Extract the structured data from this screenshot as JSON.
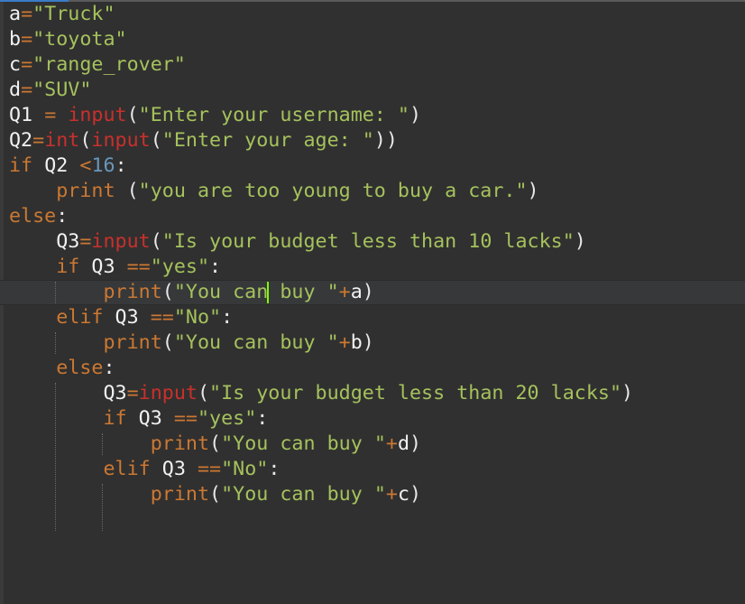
{
  "editor": {
    "theme_colors": {
      "background": "#303030",
      "keyword": "#cc7832",
      "builtin": "#c9302c",
      "string": "#a5c25c",
      "number": "#6897bb",
      "name": "#f2f2f2",
      "caret": "#7cfc00",
      "tab_active": "#3a7bc8"
    },
    "current_line": 12,
    "lines": [
      {
        "indent": 0,
        "tokens": [
          [
            "nm",
            "a"
          ],
          [
            "op",
            "="
          ],
          [
            "st",
            "\"Truck\""
          ]
        ]
      },
      {
        "indent": 0,
        "tokens": [
          [
            "nm",
            "b"
          ],
          [
            "op",
            "="
          ],
          [
            "st",
            "\"toyota\""
          ]
        ]
      },
      {
        "indent": 0,
        "tokens": [
          [
            "nm",
            "c"
          ],
          [
            "op",
            "="
          ],
          [
            "st",
            "\"range_rover\""
          ]
        ]
      },
      {
        "indent": 0,
        "tokens": [
          [
            "nm",
            "d"
          ],
          [
            "op",
            "="
          ],
          [
            "st",
            "\"SUV\""
          ]
        ]
      },
      {
        "indent": 0,
        "tokens": [
          [
            "nm",
            "Q1"
          ],
          [
            "pn",
            " "
          ],
          [
            "op",
            "="
          ],
          [
            "pn",
            " "
          ],
          [
            "bi",
            "input"
          ],
          [
            "pn",
            "("
          ],
          [
            "st",
            "\"Enter your username: \""
          ],
          [
            "pn",
            ")"
          ]
        ]
      },
      {
        "indent": 0,
        "tokens": [
          [
            "nm",
            "Q2"
          ],
          [
            "op",
            "="
          ],
          [
            "bi",
            "int"
          ],
          [
            "pn",
            "("
          ],
          [
            "bi",
            "input"
          ],
          [
            "pn",
            "("
          ],
          [
            "st",
            "\"Enter your age: \""
          ],
          [
            "pn",
            "))"
          ]
        ]
      },
      {
        "indent": 0,
        "tokens": [
          [
            "kw",
            "if"
          ],
          [
            "pn",
            " "
          ],
          [
            "nm",
            "Q2"
          ],
          [
            "pn",
            " "
          ],
          [
            "op",
            "<"
          ],
          [
            "nu",
            "16"
          ],
          [
            "pn",
            ":"
          ]
        ]
      },
      {
        "indent": 1,
        "tokens": [
          [
            "kw",
            "print"
          ],
          [
            "pn",
            " ("
          ],
          [
            "st",
            "\"you are too young to buy a car.\""
          ],
          [
            "pn",
            ")"
          ]
        ]
      },
      {
        "indent": 0,
        "tokens": [
          [
            "kw",
            "else"
          ],
          [
            "pn",
            ":"
          ]
        ]
      },
      {
        "indent": 1,
        "tokens": [
          [
            "nm",
            "Q3"
          ],
          [
            "op",
            "="
          ],
          [
            "bi",
            "input"
          ],
          [
            "pn",
            "("
          ],
          [
            "st",
            "\"Is your budget less than 10 lacks\""
          ],
          [
            "pn",
            ")"
          ]
        ]
      },
      {
        "indent": 1,
        "tokens": [
          [
            "kw",
            "if"
          ],
          [
            "pn",
            " "
          ],
          [
            "nm",
            "Q3"
          ],
          [
            "pn",
            " "
          ],
          [
            "op",
            "=="
          ],
          [
            "st",
            "\"yes\""
          ],
          [
            "pn",
            ":"
          ]
        ]
      },
      {
        "indent": 2,
        "tokens": [
          [
            "kw",
            "print"
          ],
          [
            "pn",
            "("
          ],
          [
            "st",
            "\"You can buy \""
          ],
          [
            "op",
            "+"
          ],
          [
            "nm",
            "a"
          ],
          [
            "pn",
            ")"
          ]
        ]
      },
      {
        "indent": 1,
        "tokens": [
          [
            "kw",
            "elif"
          ],
          [
            "pn",
            " "
          ],
          [
            "nm",
            "Q3"
          ],
          [
            "pn",
            " "
          ],
          [
            "op",
            "=="
          ],
          [
            "st",
            "\"No\""
          ],
          [
            "pn",
            ":"
          ]
        ]
      },
      {
        "indent": 2,
        "tokens": [
          [
            "kw",
            "print"
          ],
          [
            "pn",
            "("
          ],
          [
            "st",
            "\"You can buy \""
          ],
          [
            "op",
            "+"
          ],
          [
            "nm",
            "b"
          ],
          [
            "pn",
            ")"
          ]
        ]
      },
      {
        "indent": 1,
        "tokens": [
          [
            "kw",
            "else"
          ],
          [
            "pn",
            ":"
          ]
        ]
      },
      {
        "indent": 2,
        "tokens": [
          [
            "nm",
            "Q3"
          ],
          [
            "op",
            "="
          ],
          [
            "bi",
            "input"
          ],
          [
            "pn",
            "("
          ],
          [
            "st",
            "\"Is your budget less than 20 lacks\""
          ],
          [
            "pn",
            ")"
          ]
        ]
      },
      {
        "indent": 2,
        "tokens": [
          [
            "kw",
            "if"
          ],
          [
            "pn",
            " "
          ],
          [
            "nm",
            "Q3"
          ],
          [
            "pn",
            " "
          ],
          [
            "op",
            "=="
          ],
          [
            "st",
            "\"yes\""
          ],
          [
            "pn",
            ":"
          ]
        ]
      },
      {
        "indent": 3,
        "tokens": [
          [
            "kw",
            "print"
          ],
          [
            "pn",
            "("
          ],
          [
            "st",
            "\"You can buy \""
          ],
          [
            "op",
            "+"
          ],
          [
            "nm",
            "d"
          ],
          [
            "pn",
            ")"
          ]
        ]
      },
      {
        "indent": 2,
        "tokens": [
          [
            "kw",
            "elif"
          ],
          [
            "pn",
            " "
          ],
          [
            "nm",
            "Q3"
          ],
          [
            "pn",
            " "
          ],
          [
            "op",
            "=="
          ],
          [
            "st",
            "\"No\""
          ],
          [
            "pn",
            ":"
          ]
        ]
      },
      {
        "indent": 3,
        "tokens": [
          [
            "kw",
            "print"
          ],
          [
            "pn",
            "("
          ],
          [
            "st",
            "\"You can buy \""
          ],
          [
            "op",
            "+"
          ],
          [
            "nm",
            "c"
          ],
          [
            "pn",
            ")"
          ]
        ]
      },
      {
        "indent": 0,
        "tokens": []
      }
    ],
    "caret": {
      "line": 12,
      "column": 22
    }
  }
}
